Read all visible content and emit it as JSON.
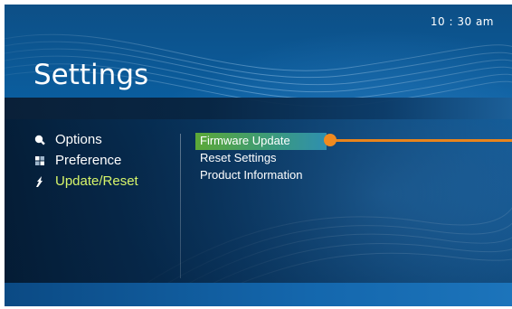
{
  "clock": "10 : 30 am",
  "title": "Settings",
  "left_menu": [
    {
      "label": "Options",
      "icon": "magnifier-icon"
    },
    {
      "label": "Preference",
      "icon": "grid-icon"
    },
    {
      "label": "Update/Reset",
      "icon": "update-arrow-icon",
      "active": true
    }
  ],
  "right_menu": [
    {
      "label": "Firmware Update",
      "selected": true
    },
    {
      "label": "Reset Settings"
    },
    {
      "label": "Product Information"
    }
  ],
  "colors": {
    "active_text": "#d7f56a",
    "selection_start": "#5ca837",
    "selection_end": "#2e8fb0",
    "focus_indicator": "#f08a1f"
  }
}
